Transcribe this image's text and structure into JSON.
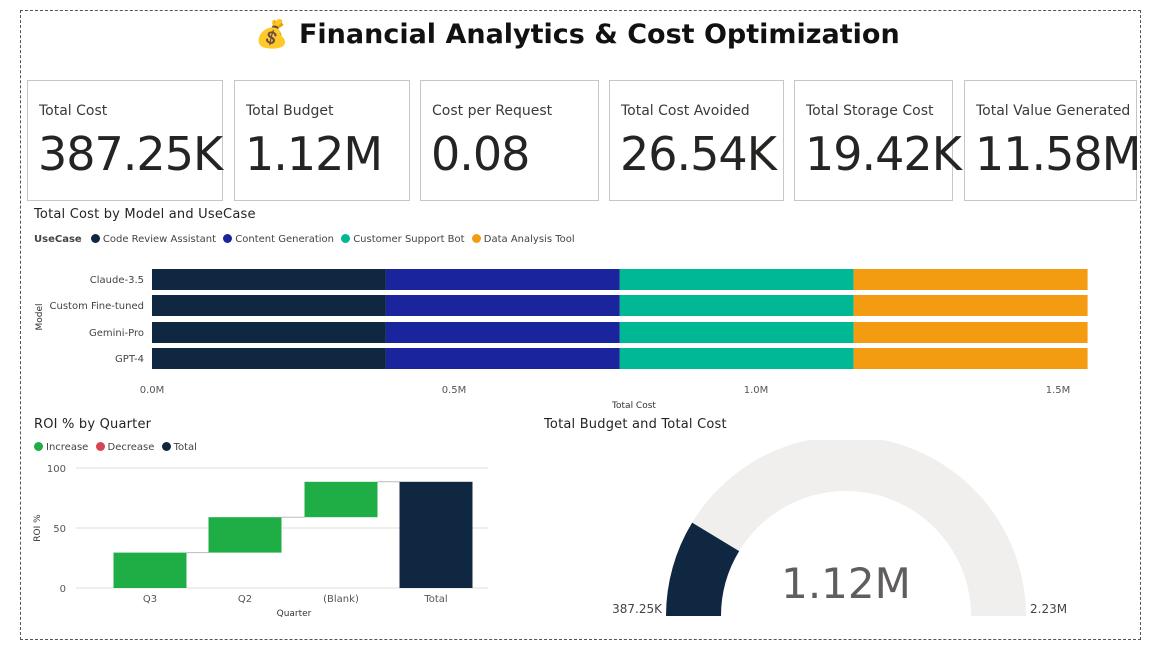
{
  "header": {
    "icon": "💰",
    "title": "Financial Analytics & Cost Optimization",
    "icon_name": "money-bag-icon"
  },
  "cards": [
    {
      "label": "Total Cost",
      "value": "387.25K"
    },
    {
      "label": "Total Budget",
      "value": "1.12M"
    },
    {
      "label": "Cost per Request",
      "value": "0.08"
    },
    {
      "label": "Total Cost Avoided",
      "value": "26.54K"
    },
    {
      "label": "Total Storage Cost",
      "value": "19.42K"
    },
    {
      "label": "Total Value Generated",
      "value": "11.58M"
    }
  ],
  "bar_chart": {
    "title": "Total Cost by Model and UseCase",
    "legend_title": "UseCase",
    "ylabel": "Model",
    "xlabel": "Total Cost",
    "x_ticks": [
      "0.0M",
      "0.5M",
      "1.0M",
      "1.5M"
    ],
    "series_names": [
      "Code Review Assistant",
      "Content Generation",
      "Customer Support Bot",
      "Data Analysis Tool"
    ],
    "colors": [
      "#0f2740",
      "#1a249c",
      "#00b894",
      "#f39c12"
    ],
    "models": [
      "Claude-3.5",
      "Custom Fine-tuned",
      "Gemini-Pro",
      "GPT-4"
    ]
  },
  "roi_chart": {
    "title": "ROI % by Quarter",
    "legend": [
      "Increase",
      "Decrease",
      "Total"
    ],
    "legend_colors": [
      "#1fad45",
      "#d64550",
      "#0f2740"
    ],
    "ylabel": "ROI %",
    "xlabel": "Quarter",
    "y_ticks": [
      "100",
      "50",
      "0"
    ]
  },
  "gauge": {
    "title": "Total Budget and Total Cost",
    "center_value": "1.12M",
    "min_label": "387.25K",
    "max_label": "2.23M",
    "fill_color": "#0f2740",
    "track_color": "#f0efee"
  },
  "chart_data": [
    {
      "type": "bar",
      "orientation": "horizontal",
      "stacked": true,
      "title": "Total Cost by Model and UseCase",
      "xlabel": "Total Cost",
      "ylabel": "Model",
      "categories": [
        "Claude-3.5",
        "Custom Fine-tuned",
        "Gemini-Pro",
        "GPT-4"
      ],
      "xlim": [
        0,
        1600000
      ],
      "series": [
        {
          "name": "Code Review Assistant",
          "values": [
            387250,
            387250,
            387250,
            387250
          ]
        },
        {
          "name": "Content Generation",
          "values": [
            387250,
            387250,
            387250,
            387250
          ]
        },
        {
          "name": "Customer Support Bot",
          "values": [
            387250,
            387250,
            387250,
            387250
          ]
        },
        {
          "name": "Data Analysis Tool",
          "values": [
            387250,
            387250,
            387250,
            387250
          ]
        }
      ]
    },
    {
      "type": "bar",
      "subtype": "waterfall",
      "title": "ROI % by Quarter",
      "xlabel": "Quarter",
      "ylabel": "ROI %",
      "categories": [
        "Q3",
        "Q2",
        "(Blank)",
        "Total"
      ],
      "kinds": [
        "increase",
        "increase",
        "increase",
        "total"
      ],
      "starts": [
        0,
        29.5,
        59,
        0
      ],
      "values": [
        29.5,
        29.5,
        29.5,
        88.5
      ],
      "ylim": [
        0,
        100
      ]
    },
    {
      "type": "gauge",
      "title": "Total Budget and Total Cost",
      "value": 1120000,
      "target_value": 387250,
      "min": 0,
      "max": 2230000
    }
  ]
}
